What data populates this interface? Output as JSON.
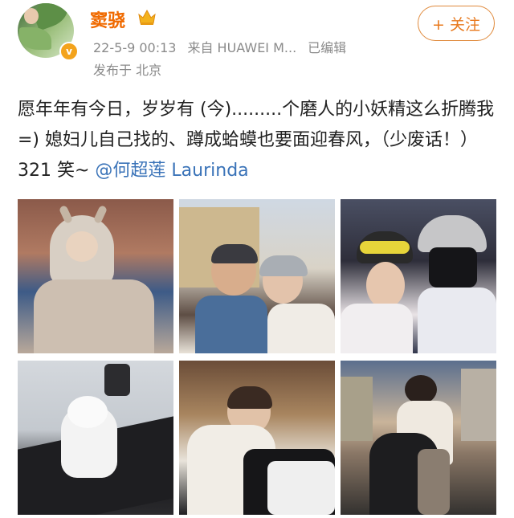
{
  "post": {
    "user": {
      "name": "窦骁",
      "verified": "v"
    },
    "follow_label": "+ 关注",
    "time": "22-5-9 00:13",
    "source": "来自 HUAWEI M...",
    "edited": "已编辑",
    "location": "发布于 北京",
    "text_main": "愿年年有今日，岁岁有 (今).........个磨人的小妖精这么折腾我 =)  媳妇儿自己找的、蹲成蛤蟆也要面迎春风，（少废话！）321 笑~ ",
    "mention": "@何超莲 Laurinda",
    "photos": [
      {
        "icon": "photo-girl-deer-hoodie"
      },
      {
        "icon": "photo-couple-selfie-castle"
      },
      {
        "icon": "photo-couple-ski-goggles"
      },
      {
        "icon": "photo-snow-figure"
      },
      {
        "icon": "photo-woman-cooking"
      },
      {
        "icon": "photo-couple-rooftop"
      }
    ]
  },
  "colors": {
    "username": "#f06a00",
    "link": "#3a73b8",
    "meta": "#8a8a8a",
    "follow": "#e8791d",
    "badge": "#f3a31c"
  }
}
